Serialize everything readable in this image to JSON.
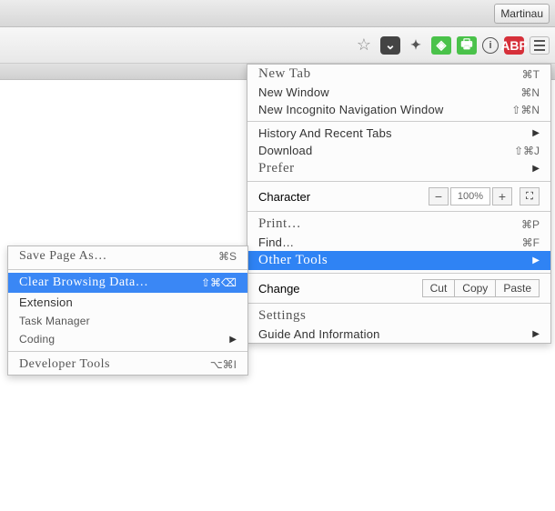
{
  "header": {
    "profile_button": "Martinau"
  },
  "main_menu": {
    "new_tab": "New Tab",
    "new_tab_key": "⌘T",
    "new_window": "New Window",
    "new_window_key": "⌘N",
    "incognito": "New Incognito Navigation Window",
    "incognito_key": "⇧⌘N",
    "history": "History And Recent Tabs",
    "download": "Download",
    "download_key": "⇧⌘J",
    "prefer": "Prefer",
    "character": "Character",
    "zoom_value": "100%",
    "print": "Print…",
    "print_key": "⌘P",
    "find": "Find…",
    "find_key": "⌘F",
    "other_tools": "Other Tools",
    "change": "Change",
    "cut": "Cut",
    "copy": "Copy",
    "paste": "Paste",
    "settings": "Settings",
    "guide": "Guide And Information"
  },
  "submenu": {
    "save_page": "Save Page As…",
    "save_page_key": "⌘S",
    "clear_data": "Clear Browsing Data…",
    "clear_data_key": "⇧⌘⌫",
    "extension": "Extension",
    "task_manager": "Task Manager",
    "coding": "Coding",
    "dev_tools": "Developer Tools",
    "dev_tools_key": "⌥⌘I"
  }
}
